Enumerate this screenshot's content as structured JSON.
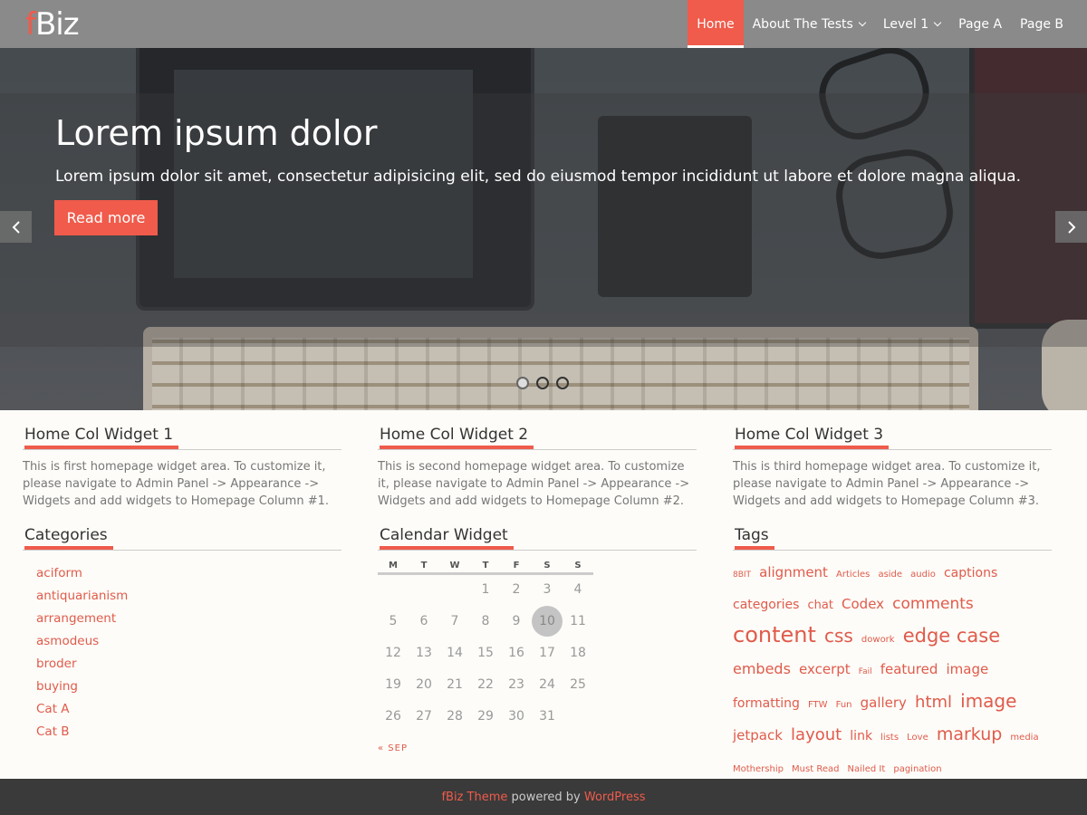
{
  "header": {
    "logo_f": "f",
    "logo_rest": "Biz",
    "nav": [
      {
        "label": "Home"
      },
      {
        "label": "About The Tests"
      },
      {
        "label": "Level 1"
      },
      {
        "label": "Page A"
      },
      {
        "label": "Page B"
      }
    ]
  },
  "hero": {
    "title": "Lorem ipsum dolor",
    "text": "Lorem ipsum dolor sit amet, consectetur adipisicing elit, sed do eiusmod tempor incididunt ut labore et dolore magna aliqua.",
    "button": "Read more",
    "prev_icon": "chevron-left-icon",
    "next_icon": "chevron-right-icon",
    "slide_count": 3,
    "active_slide": 1
  },
  "widgets": {
    "col1": {
      "title": "Home Col Widget 1",
      "text": "This is first homepage widget area. To customize it, please navigate to Admin Panel -> Appearance -> Widgets and add widgets to Homepage Column #1."
    },
    "col2": {
      "title": "Home Col Widget 2",
      "text": "This is second homepage widget area. To customize it, please navigate to Admin Panel -> Appearance -> Widgets and add widgets to Homepage Column #2."
    },
    "col3": {
      "title": "Home Col Widget 3",
      "text": "This is third homepage widget area. To customize it, please navigate to Admin Panel -> Appearance -> Widgets and add widgets to Homepage Column #3."
    }
  },
  "categories": {
    "title": "Categories",
    "items": [
      "aciform",
      "antiquarianism",
      "arrangement",
      "asmodeus",
      "broder",
      "buying",
      "Cat A",
      "Cat B"
    ]
  },
  "calendar": {
    "title": "Calendar Widget",
    "weekdays": [
      "M",
      "T",
      "W",
      "T",
      "F",
      "S",
      "S"
    ],
    "weeks": [
      [
        "",
        "",
        "",
        "1",
        "2",
        "3",
        "4"
      ],
      [
        "5",
        "6",
        "7",
        "8",
        "9",
        "10",
        "11"
      ],
      [
        "12",
        "13",
        "14",
        "15",
        "16",
        "17",
        "18"
      ],
      [
        "19",
        "20",
        "21",
        "22",
        "23",
        "24",
        "25"
      ],
      [
        "26",
        "27",
        "28",
        "29",
        "30",
        "31",
        ""
      ]
    ],
    "today": "10",
    "prev_link": "« SEP"
  },
  "tags": {
    "title": "Tags",
    "items": [
      {
        "label": "8BIT",
        "size": 9
      },
      {
        "label": "alignment",
        "size": 15
      },
      {
        "label": "Articles",
        "size": 10
      },
      {
        "label": "aside",
        "size": 10
      },
      {
        "label": "audio",
        "size": 10
      },
      {
        "label": "captions",
        "size": 14
      },
      {
        "label": "categories",
        "size": 14
      },
      {
        "label": "chat",
        "size": 13
      },
      {
        "label": "Codex",
        "size": 15
      },
      {
        "label": "comments",
        "size": 17
      },
      {
        "label": "content",
        "size": 24
      },
      {
        "label": "css",
        "size": 20
      },
      {
        "label": "dowork",
        "size": 10
      },
      {
        "label": "edge case",
        "size": 21
      },
      {
        "label": "embeds",
        "size": 16
      },
      {
        "label": "excerpt",
        "size": 15
      },
      {
        "label": "Fail",
        "size": 9
      },
      {
        "label": "featured",
        "size": 15
      },
      {
        "label": "image",
        "size": 15
      },
      {
        "label": "formatting",
        "size": 14
      },
      {
        "label": "FTW",
        "size": 10
      },
      {
        "label": "Fun",
        "size": 10
      },
      {
        "label": "gallery",
        "size": 15
      },
      {
        "label": "html",
        "size": 18
      },
      {
        "label": "image",
        "size": 20
      },
      {
        "label": "jetpack",
        "size": 15
      },
      {
        "label": "layout",
        "size": 18
      },
      {
        "label": "link",
        "size": 14
      },
      {
        "label": "lists",
        "size": 10
      },
      {
        "label": "Love",
        "size": 10
      },
      {
        "label": "markup",
        "size": 19
      },
      {
        "label": "media",
        "size": 10
      },
      {
        "label": "Mothership",
        "size": 10
      },
      {
        "label": "Must Read",
        "size": 10
      },
      {
        "label": "Nailed It",
        "size": 10
      },
      {
        "label": "pagination",
        "size": 10
      }
    ]
  },
  "footer": {
    "theme_link": "fBiz Theme",
    "middle": " powered by ",
    "wp_link": "WordPress"
  },
  "colors": {
    "accent": "#f05b4b",
    "header": "#8a8a8a",
    "footer": "#3a3a3a"
  }
}
